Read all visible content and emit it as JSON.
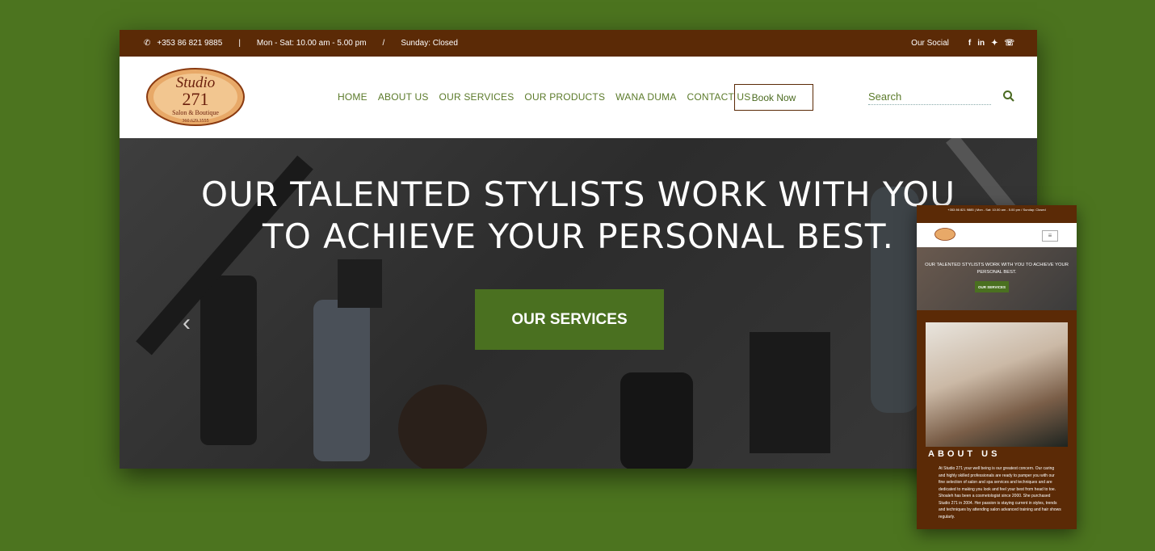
{
  "topbar": {
    "phone": "+353 86 821 9885",
    "sep1": "|",
    "hours": "Mon - Sat: 10.00 am - 5.00 pm",
    "sep2": "/",
    "sunday": "Sunday: Closed",
    "social_label": "Our Social",
    "social_icons": [
      "facebook-icon",
      "linkedin-icon",
      "twitter-icon",
      "whatsapp-icon"
    ]
  },
  "logo": {
    "line1": "Studio",
    "line2": "271",
    "line3": "Salon & Boutique",
    "line4": "360.629.3555"
  },
  "nav": {
    "items": [
      "HOME",
      "ABOUT US",
      "OUR SERVICES",
      "OUR PRODUCTS",
      "WANA DUMA",
      "CONTACT US"
    ],
    "book": "Book Now"
  },
  "search": {
    "placeholder": "Search"
  },
  "hero": {
    "title_line1": "OUR TALENTED STYLISTS WORK WITH YOU",
    "title_line2": "TO ACHIEVE YOUR PERSONAL BEST.",
    "button": "OUR SERVICES",
    "prev": "‹"
  },
  "mobile": {
    "topbar": "+353 86 821 9885  |  Mon - Sat: 10.00 am - 5.00 pm  /  Sunday: Closed",
    "menu": "≡",
    "hero_title": "OUR TALENTED STYLISTS WORK WITH YOU TO ACHIEVE YOUR PERSONAL BEST.",
    "hero_button": "OUR SERVICES",
    "about_title": "ABOUT US",
    "about_text": "At Studio 271 your well being is our greatest concern. Our caring and highly skilled professionals are ready to pamper you with our fine selection of salon and spa services and techniques and are dedicated to making you look and feel your best from head to toe. Shoaleh has been a cosmetologist since 2000. She purchased Studio 271 in 2004. Her passion is staying current in styles, trends and techniques by attending salon advanced training and hair shows regularly."
  },
  "colors": {
    "brand_brown": "#5b2a06",
    "brand_green": "#4a7020",
    "background": "#4c741f"
  }
}
